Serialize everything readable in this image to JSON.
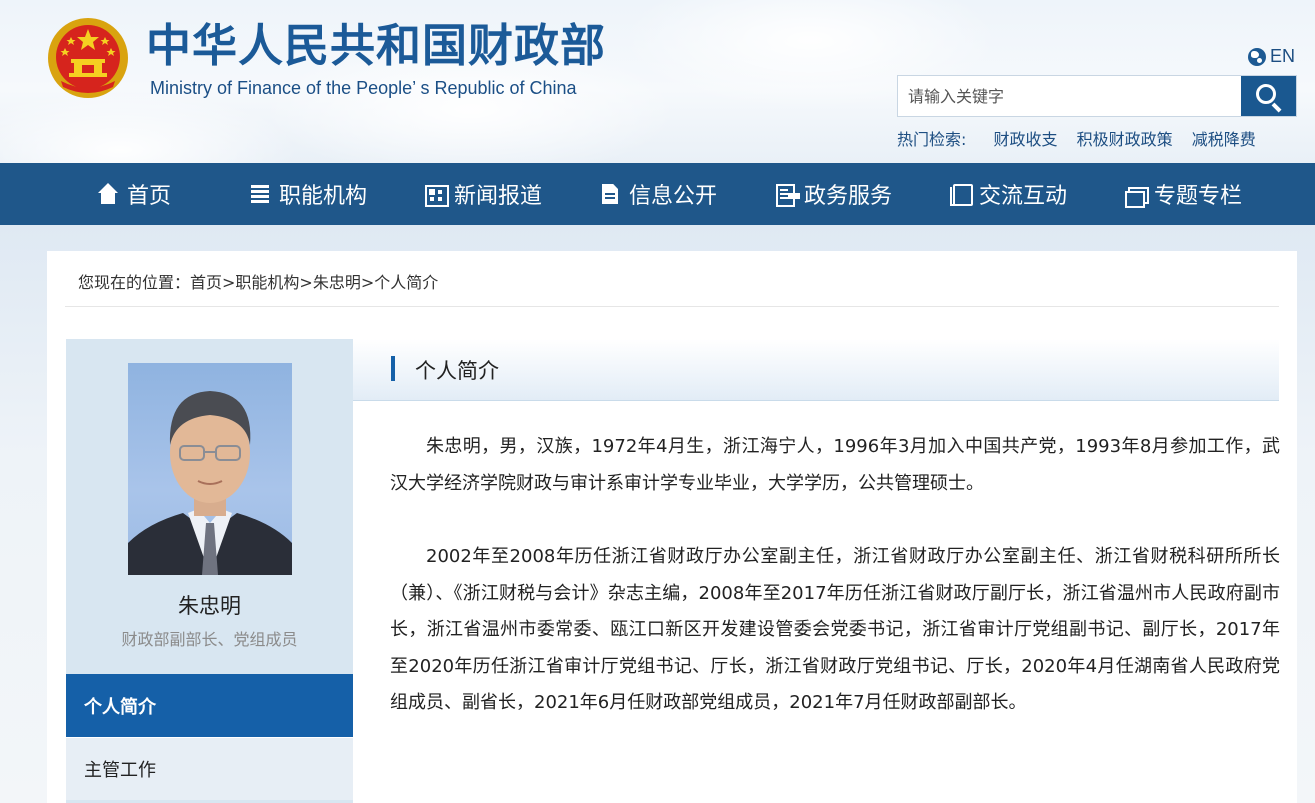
{
  "header": {
    "title": "中华人民共和国财政部",
    "subtitle": "Ministry of Finance of the People’ s Republic of China",
    "lang_label": "EN",
    "search_placeholder": "请输入关键字",
    "hot_label": "热门检索:",
    "hot_keywords": [
      "财政收支",
      "积极财政政策",
      "减税降费"
    ]
  },
  "nav": {
    "items": [
      {
        "label": "首页",
        "icon": "home-icon"
      },
      {
        "label": "职能机构",
        "icon": "list-icon"
      },
      {
        "label": "新闻报道",
        "icon": "news-icon"
      },
      {
        "label": "信息公开",
        "icon": "document-icon"
      },
      {
        "label": "政务服务",
        "icon": "service-icon"
      },
      {
        "label": "交流互动",
        "icon": "exchange-icon"
      },
      {
        "label": "专题专栏",
        "icon": "topic-icon"
      }
    ]
  },
  "breadcrumb": "您现在的位置：首页>职能机构>朱忠明>个人简介",
  "profile": {
    "name": "朱忠明",
    "title": "财政部副部长、党组成员"
  },
  "sidebar": {
    "active": "个人简介",
    "items": [
      "主管工作"
    ]
  },
  "panel": {
    "title": "个人简介",
    "paragraphs": [
      "朱忠明，男，汉族，1972年4月生，浙江海宁人，1996年3月加入中国共产党，1993年8月参加工作，武汉大学经济学院财政与审计系审计学专业毕业，大学学历，公共管理硕士。",
      "2002年至2008年历任浙江省财政厅办公室副主任，浙江省财政厅办公室副主任、浙江省财税科研所所长（兼）、《浙江财税与会计》杂志主编，2008年至2017年历任浙江省财政厅副厅长，浙江省温州市人民政府副市长，浙江省温州市委常委、瓯江口新区开发建设管委会党委书记，浙江省审计厅党组副书记、副厅长，2017年至2020年历任浙江省审计厅党组书记、厅长，浙江省财政厅党组书记、厅长，2020年4月任湖南省人民政府党组成员、副省长，2021年6月任财政部党组成员，2021年7月任财政部副部长。"
    ]
  },
  "colors": {
    "nav_bg": "#1f578a",
    "accent": "#1560a8",
    "title_blue": "#1b5a98"
  }
}
